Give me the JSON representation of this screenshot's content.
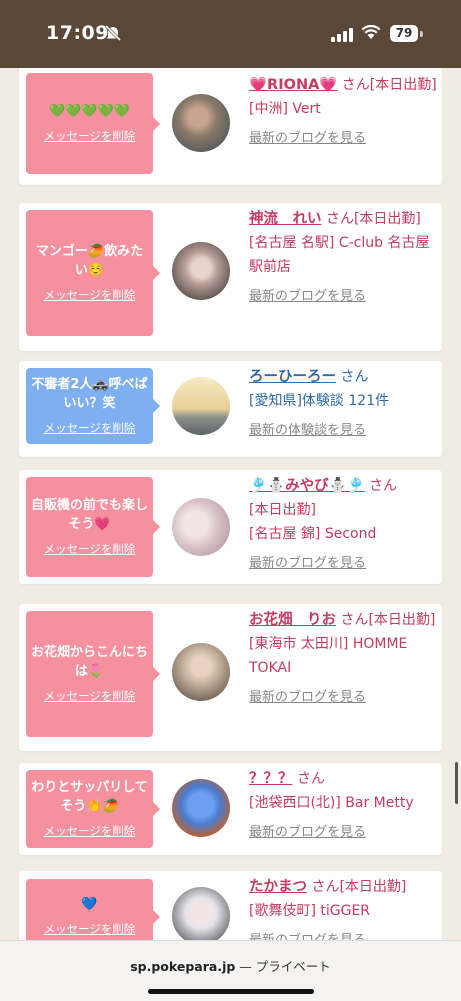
{
  "status_bar": {
    "time": "17:09",
    "battery": "79"
  },
  "cards": [
    {
      "bubble_text": "💚💚💚💚💚",
      "bubble_color": "pink",
      "delete_label": "メッセージを削除",
      "name": "💗RIONA💗",
      "suffix": "さん[本日出勤]",
      "area": "[中洲] Vert",
      "link": "最新のブログを見る",
      "avatar_colors": [
        "#8a7a6a",
        "#3d4a55"
      ]
    },
    {
      "bubble_text": "マンゴー🥭飲みたい☺️",
      "bubble_color": "pink",
      "delete_label": "メッセージを削除",
      "name": "神流　れい",
      "suffix": "さん[本日出勤]",
      "area": "[名古屋 名駅] C-club 名古屋駅前店",
      "link": "最新のブログを見る",
      "avatar_colors": [
        "#d9c8c4",
        "#2b2626"
      ]
    },
    {
      "bubble_text": "不審者2人🚓呼べばいい？笑",
      "bubble_color": "blue",
      "delete_label": "メッセージを削除",
      "name": "ろーひーろー",
      "suffix": "さん",
      "area": "[愛知県]体験談 121件",
      "link": "最新の体験談を見る",
      "avatar_colors": [
        "#f3e4b0",
        "#8b8f8a"
      ]
    },
    {
      "bubble_text": "自販機の前でも楽しそう💗",
      "bubble_color": "pink",
      "delete_label": "メッセージを削除",
      "name": "🎐⛄みやび⛄🎐",
      "suffix": "さん",
      "area_top": "[本日出勤]",
      "area": "[名古屋 錦] Second",
      "link": "最新のブログを見る",
      "avatar_colors": [
        "#e8d7da",
        "#c8b2b8"
      ]
    },
    {
      "bubble_text": "お花畑からこんにちは🌷",
      "bubble_color": "pink",
      "delete_label": "メッセージを削除",
      "name": "お花畑　りお",
      "suffix": "さん[本日出勤]",
      "area": "[東海市 太田川] HOMME TOKAI",
      "link": "最新のブログを見る",
      "avatar_colors": [
        "#c8b4a0",
        "#4a3b33"
      ]
    },
    {
      "bubble_text": "わりとサッパリしてそう👏🥭",
      "bubble_color": "pink",
      "delete_label": "メッセージを削除",
      "name": "？？？",
      "suffix": "さん",
      "area": "[池袋西口(北)] Bar Metty",
      "link": "最新のブログを見る",
      "avatar_colors": [
        "#4a7bd0",
        "#c2602a"
      ]
    },
    {
      "bubble_text": "💙",
      "bubble_color": "pink",
      "delete_label": "メッセージを削除",
      "name": "たかまつ",
      "suffix": "さん[本日出勤]",
      "area": "[歌舞伎町] tiGGER",
      "link": "最新のブログを見る",
      "avatar_colors": [
        "#e6e4ea",
        "#2a2a33"
      ]
    }
  ],
  "url_bar": {
    "domain": "sp.pokepara.jp",
    "mode": "— プライベート"
  }
}
